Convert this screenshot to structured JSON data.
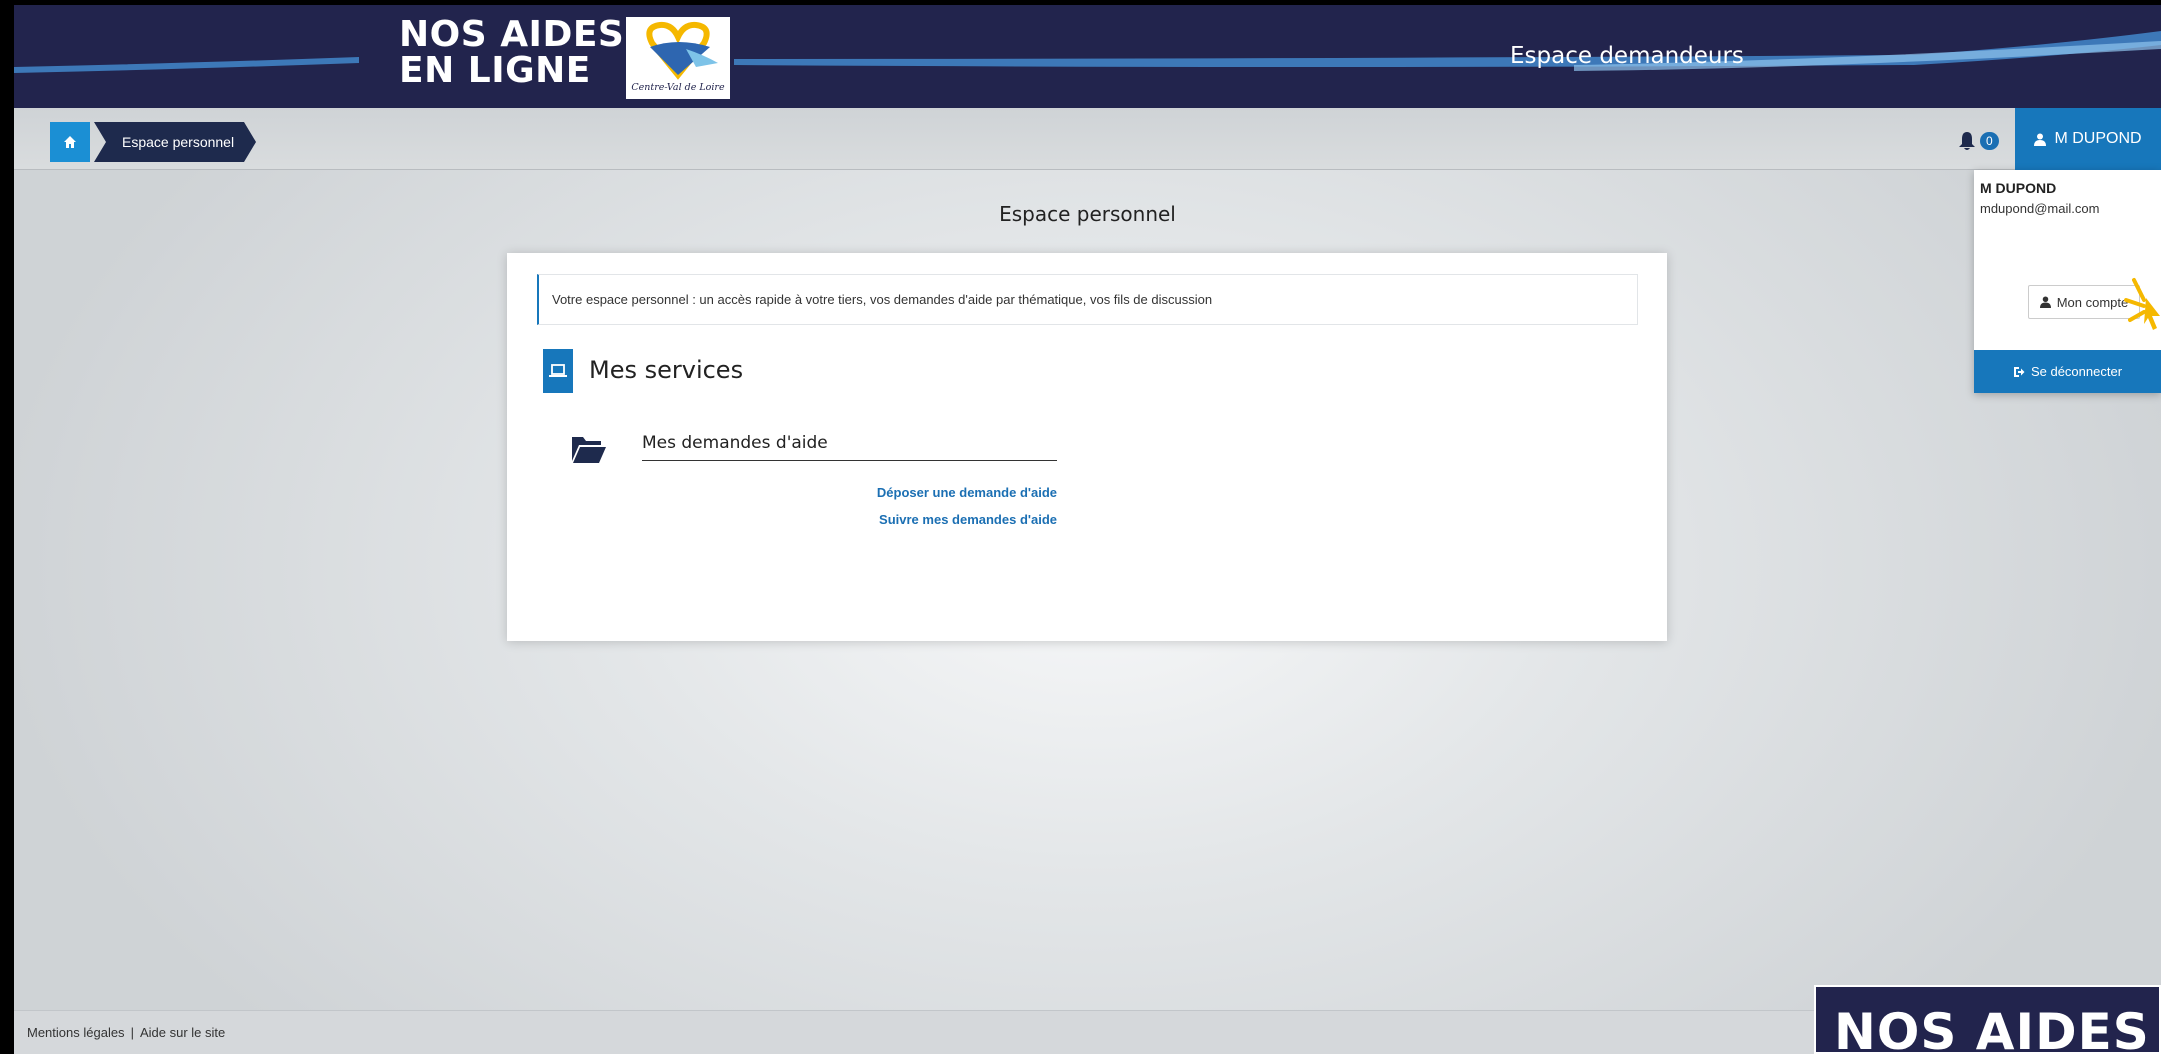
{
  "header": {
    "logo_line1": "NOS AIDES",
    "logo_line2": "EN LIGNE",
    "region_caption": "Centre-Val de Loire",
    "title": "Espace demandeurs"
  },
  "breadcrumb": {
    "home_icon": "home-icon",
    "items": [
      {
        "label": "Espace personnel"
      }
    ]
  },
  "notifications": {
    "icon": "bell-icon",
    "count": "0"
  },
  "user": {
    "button_label": "M DUPOND",
    "dropdown": {
      "name": "M DUPOND",
      "email": "mdupond@mail.com",
      "account_label": "Mon compte",
      "logout_label": "Se déconnecter"
    }
  },
  "main": {
    "title": "Espace personnel",
    "intro": "Votre espace personnel : un accès rapide à votre tiers, vos demandes d'aide par thématique, vos fils de discussion",
    "services_title": "Mes services",
    "demandes": {
      "title": "Mes demandes d'aide",
      "links": [
        "Déposer une demande d'aide",
        "Suivre mes demandes d'aide"
      ]
    }
  },
  "footer": {
    "links": [
      "Mentions légales",
      "Aide sur le site"
    ],
    "separator": "|",
    "corner_logo": "NOS AIDES"
  },
  "colors": {
    "header_bg": "#22244d",
    "accent": "#1777bb",
    "breadcrumb_home": "#1b8fd4",
    "link": "#1b6fb3",
    "cursor_highlight": "#f5b800"
  }
}
